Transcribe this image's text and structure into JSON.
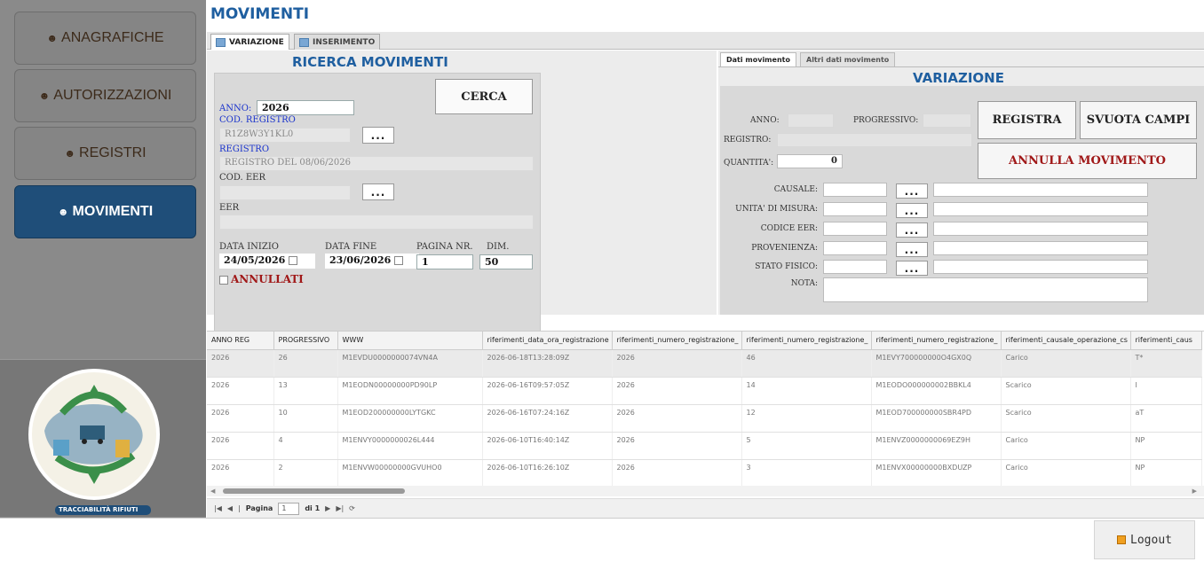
{
  "sidebar": {
    "items": [
      {
        "label": "ANAGRAFICHE"
      },
      {
        "label": "AUTORIZZAZIONI"
      },
      {
        "label": "REGISTRI"
      },
      {
        "label": "MOVIMENTI",
        "active": true
      }
    ],
    "logo_text": "TRACCIABILITÀ RIFIUTI"
  },
  "page_title": "MOVIMENTI",
  "tabs": [
    "VARIAZIONE",
    "INSERIMENTO"
  ],
  "search": {
    "title": "RICERCA MOVIMENTI",
    "anno_label": "ANNO:",
    "anno_value": "2026",
    "cerca_label": "CERCA",
    "cod_registro_label": "COD. REGISTRO",
    "cod_registro_value": "R1Z8W3Y1KL0",
    "registro_label": "REGISTRO",
    "registro_value": "REGISTRO DEL 08/06/2026",
    "cod_eer_label": "COD. EER",
    "eer_label": "EER",
    "dots": "...",
    "data_inizio_label": "DATA INIZIO",
    "data_inizio_value": "24/05/2026",
    "data_fine_label": "DATA FINE",
    "data_fine_value": "23/06/2026",
    "pagina_label": "PAGINA NR.",
    "pagina_value": "1",
    "dim_label": "DIM.",
    "dim_value": "50",
    "annullati_label": "ANNULLATI"
  },
  "detail": {
    "tabs": [
      "Dati movimento",
      "Altri dati movimento"
    ],
    "title": "VARIAZIONE",
    "anno_label": "ANNO:",
    "progressivo_label": "PROGRESSIVO:",
    "registro_label": "REGISTRO:",
    "quantita_label": "QUANTITA':",
    "quantita_value": "0",
    "registra_label": "REGISTRA",
    "svuota_label": "SVUOTA CAMPI",
    "annulla_label": "ANNULLA MOVIMENTO",
    "causale_label": "CAUSALE:",
    "unita_label": "UNITA' DI MISURA:",
    "codice_eer_label": "CODICE EER:",
    "provenienza_label": "PROVENIENZA:",
    "stato_label": "STATO FISICO:",
    "nota_label": "NOTA:"
  },
  "grid": {
    "columns": [
      "ANNO REG",
      "PROGRESSIVO",
      "WWW",
      "riferimenti_data_ora_registrazione",
      "riferimenti_numero_registrazione_",
      "riferimenti_numero_registrazione_",
      "riferimenti_numero_registrazione_",
      "riferimenti_causale_operazione_cs",
      "riferimenti_caus"
    ],
    "rows": [
      [
        "2026",
        "26",
        "M1EVDU0000000074VN4A",
        "2026-06-18T13:28:09Z",
        "2026",
        "46",
        "M1EVY700000000O4GX0Q",
        "Carico",
        "T*"
      ],
      [
        "2026",
        "13",
        "M1EODN00000000PD90LP",
        "2026-06-16T09:57:05Z",
        "2026",
        "14",
        "M1EODO000000002BBKL4",
        "Scarico",
        "I"
      ],
      [
        "2026",
        "10",
        "M1EOD200000000LYTGKC",
        "2026-06-16T07:24:16Z",
        "2026",
        "12",
        "M1EOD700000000SBR4PD",
        "Scarico",
        "aT"
      ],
      [
        "2026",
        "4",
        "M1ENVY0000000026L444",
        "2026-06-10T16:40:14Z",
        "2026",
        "5",
        "M1ENVZ0000000069EZ9H",
        "Carico",
        "NP"
      ],
      [
        "2026",
        "2",
        "M1ENVW00000000GVUHO0",
        "2026-06-10T16:26:10Z",
        "2026",
        "3",
        "M1ENVX00000000BXDUZP",
        "Carico",
        "NP"
      ]
    ]
  },
  "pager": {
    "pagina_label": "Pagina",
    "page": "1",
    "of_label": "di 1"
  },
  "footer": {
    "logout_label": "Logout"
  }
}
